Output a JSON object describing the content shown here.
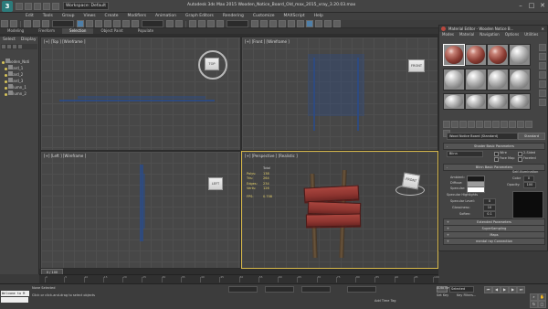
{
  "titlebar": {
    "workspace": "Workspace: Default",
    "title": "Autodesk 3ds Max 2015     Wooden_Notice_Board_Old_max_2015_vray_3.20.03.max",
    "minimize": "–",
    "maximize": "□",
    "close": "✕"
  },
  "menu": [
    "Edit",
    "Tools",
    "Group",
    "Views",
    "Create",
    "Modifiers",
    "Animation",
    "Graph Editors",
    "Rendering",
    "Customize",
    "MAXScript",
    "Help"
  ],
  "ribbon_tabs": [
    "Modeling",
    "Freeform",
    "Selection",
    "Object Paint",
    "Populate"
  ],
  "explorer": {
    "tabs": [
      "Select",
      "Display"
    ],
    "items": [
      "Wooden_Noti",
      "Board_1",
      "Board_2",
      "Board_3",
      "Column_1",
      "Column_2"
    ]
  },
  "viewports": {
    "top": {
      "label": "[+] [Top ] [Wireframe ]",
      "cube": "TOP"
    },
    "front": {
      "label": "[+] [Front ] [Wireframe ]",
      "cube": "FRONT"
    },
    "left": {
      "label": "[+] [Left ] [Wireframe ]",
      "cube": "LEFT"
    },
    "persp": {
      "label": "[+] [Perspective ] [Realistic ]",
      "cube": "FRONT"
    }
  },
  "stats": {
    "header": "Total",
    "rows": [
      {
        "k": "Polys:",
        "v": "138"
      },
      {
        "k": "Tris:",
        "v": "264"
      },
      {
        "k": "Edges:",
        "v": "234"
      },
      {
        "k": "Verts:",
        "v": "126"
      }
    ],
    "fps_label": "FPS:",
    "fps": "0.708"
  },
  "material_editor": {
    "title": "Material Editor - Wooden Notice B...",
    "menus": [
      "Modes",
      "Material",
      "Navigation",
      "Options",
      "Utilities"
    ],
    "material_name": "Wood Notice Board (Standard)",
    "material_type": "Standard",
    "rollouts": {
      "shader_basic": "Shader Basic Parameters",
      "blinn_basic": "Blinn Basic Parameters",
      "extended": "Extended Parameters",
      "supersampling": "SuperSampling",
      "maps": "Maps",
      "mental_ray": "mental ray Connection"
    },
    "shader_type": "Blinn",
    "wire": "Wire",
    "two_sided": "2-Sided",
    "face_map": "Face Map",
    "faceted": "Faceted",
    "self_illum": "Self-Illumination",
    "color_label": "Color",
    "color_value": "0",
    "ambient": "Ambient:",
    "diffuse": "Diffuse:",
    "specular": "Specular:",
    "opacity_label": "Opacity:",
    "opacity_value": "100",
    "spec_highlights": "Specular Highlights",
    "spec_level_label": "Specular Level:",
    "spec_level": "0",
    "glossiness_label": "Glossiness:",
    "glossiness": "10",
    "soften_label": "Soften:",
    "soften": "0.1"
  },
  "timeline": {
    "frame": "0 / 100",
    "ticks": [
      "0",
      "5",
      "10",
      "15",
      "20",
      "25",
      "30",
      "35",
      "40",
      "45",
      "50",
      "55",
      "60",
      "65",
      "70",
      "75",
      "80",
      "85",
      "90",
      "95",
      "100"
    ]
  },
  "status": {
    "maxscript": "Welcome to M",
    "selection": "None Selected",
    "prompt": "Click or click-and-drag to select objects",
    "autokey": "Auto Key",
    "selected_dd": "Selected",
    "set_key": "Set Key",
    "key_filters": "Key Filters...",
    "add_time_tag": "Add Time Tag"
  },
  "colors": {
    "accent": "#d7b84a",
    "wood": "#a9453e",
    "selected_ui": "#4f7fa8"
  }
}
